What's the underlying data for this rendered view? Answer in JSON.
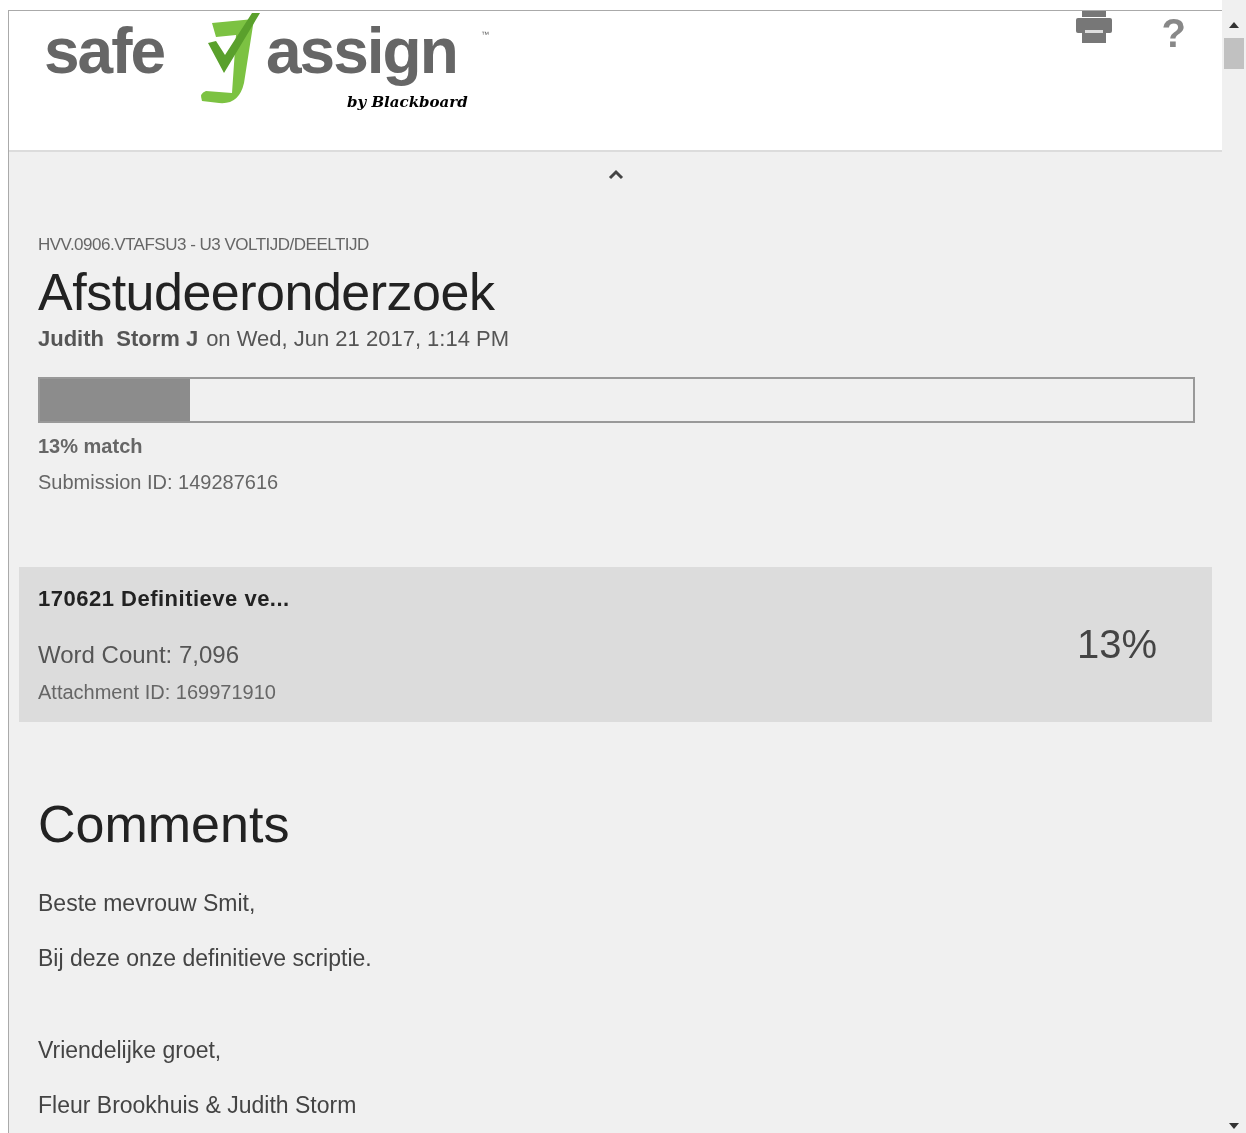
{
  "logo": {
    "word_left": "safe",
    "word_right": "assign",
    "trademark": "™",
    "byline": "by Blackboard"
  },
  "course": "HVV.0906.VTAFSU3 - U3 VOLTIJD/DEELTIJD",
  "title": "Afstudeeronderzoek",
  "submitted": {
    "author": "Judith  Storm J",
    "date": "on Wed, Jun 21 2017, 1:14 PM"
  },
  "match": {
    "level": 0.13,
    "label": "13% match",
    "submission_id": "Submission ID: 149287616"
  },
  "attachment": {
    "name": "170621 Definitieve ve...",
    "word_count": "Word Count: 7,096",
    "attachment_id": "Attachment ID: 169971910",
    "percent": "13%"
  },
  "comments": {
    "heading": "Comments",
    "paragraphs": [
      [
        "Beste mevrouw Smit,",
        "Bij deze onze definitieve scriptie."
      ],
      [
        "Vriendelijke groet,",
        "Fleur Brookhuis & Judith Storm"
      ]
    ]
  },
  "help": "?"
}
